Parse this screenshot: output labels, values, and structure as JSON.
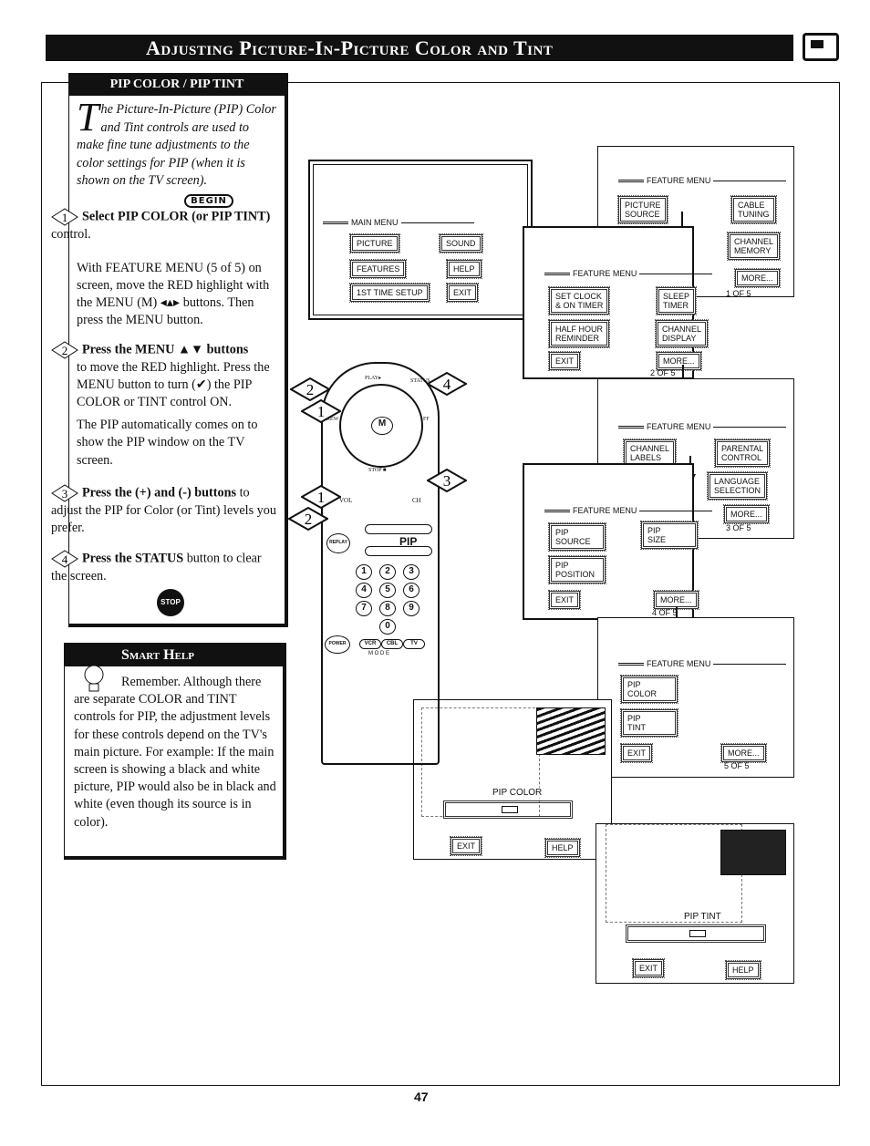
{
  "title": "Adjusting Picture-In-Picture Color and Tint",
  "section": {
    "header": "PIP COLOR / PIP TINT",
    "intro_dropcap": "T",
    "intro": "he Picture-In-Picture (PIP) Color and Tint controls are used to make fine tune adjustments to the color settings for PIP (when it is shown on the TV screen).",
    "begin": "BEGIN",
    "steps": [
      {
        "num": "1",
        "lead": "Select PIP COLOR (or PIP TINT)",
        "rest": " control.",
        "body": "With FEATURE MENU (5 of 5) on screen, move the RED highlight with the MENU (M) ◂▴▸ buttons. Then press the MENU button."
      },
      {
        "num": "2",
        "lead": "Press the MENU ▲▼ buttons",
        "rest": "",
        "body": "to move the RED highlight. Press the MENU button to turn (✔) the PIP COLOR or TINT control ON.",
        "body2": "The PIP automatically comes on to show the PIP window on the TV screen."
      },
      {
        "num": "3",
        "lead": "Press the (+) and (-) buttons",
        "rest": " to adjust the PIP for Color (or Tint) levels you prefer."
      },
      {
        "num": "4",
        "lead": "Press the STATUS",
        "rest": " button to clear the screen."
      }
    ],
    "stop": "STOP"
  },
  "smart_help": {
    "header": "Smart Help",
    "text": "Remember. Although there are separate COLOR and TINT controls for PIP, the adjustment levels for these controls depend on the TV's main picture. For example: If the main screen is showing a black and white picture, PIP would also be in black and white (even though its source is in color)."
  },
  "main_menu": {
    "title": "MAIN MENU",
    "items": [
      "PICTURE",
      "SOUND",
      "FEATURES",
      "HELP",
      "1ST TIME SETUP",
      "EXIT"
    ]
  },
  "feature_menus": [
    {
      "title": "FEATURE MENU",
      "items": [
        "PICTURE\nSOURCE",
        "CABLE\nTUNING",
        "CHANNEL\nMEMORY",
        "MORE..."
      ],
      "page": "1 OF 5"
    },
    {
      "title": "FEATURE MENU",
      "items": [
        "SET CLOCK\n& ON TIMER",
        "SLEEP\nTIMER",
        "HALF HOUR\nREMINDER",
        "CHANNEL\nDISPLAY",
        "EXIT",
        "MORE..."
      ],
      "page": "2 OF 5"
    },
    {
      "title": "FEATURE MENU",
      "items": [
        "CHANNEL\nLABELS",
        "PARENTAL\nCONTROL",
        "LANGUAGE\nSELECTION",
        "MORE..."
      ],
      "page": "3 OF 5"
    },
    {
      "title": "FEATURE MENU",
      "items": [
        "PIP\nSOURCE",
        "PIP\nSIZE",
        "PIP\nPOSITION",
        "EXIT",
        "MORE..."
      ],
      "page": "4 OF 5"
    },
    {
      "title": "FEATURE MENU",
      "items": [
        "PIP\nCOLOR",
        "PIP\nTINT",
        "EXIT",
        "MORE..."
      ],
      "page": "5 OF 5"
    }
  ],
  "pip_color_screen": {
    "label": "PIP COLOR",
    "exit": "EXIT",
    "help": "HELP",
    "level": 0.45
  },
  "pip_tint_screen": {
    "label": "PIP TINT",
    "exit": "EXIT",
    "help": "HELP",
    "level": 0.45
  },
  "remote": {
    "play": "PLAY▸",
    "rew": "REW",
    "ff": "FF",
    "stop": "STOP ■",
    "status": "STATUS",
    "menu": "M",
    "vol": "VOL",
    "ch": "CH",
    "pip": "PIP",
    "replay": "REPLAY",
    "power": "POWER",
    "mode": "M O D E",
    "mode_keys": [
      "VCR",
      "CBL",
      "TV"
    ],
    "digits": [
      "1",
      "2",
      "3",
      "4",
      "5",
      "6",
      "7",
      "8",
      "9",
      "0"
    ],
    "callouts": [
      "2",
      "1",
      "4",
      "1",
      "3",
      "2"
    ]
  },
  "page_number": "47"
}
